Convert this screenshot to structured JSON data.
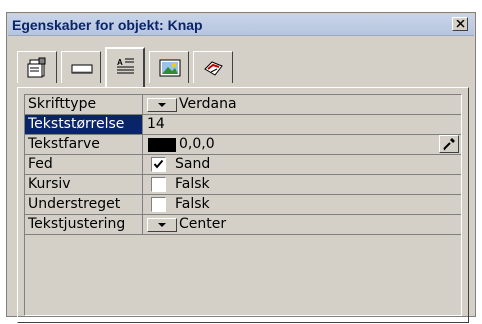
{
  "window": {
    "title": "Egenskaber for objekt: Knap"
  },
  "tabs": [
    {
      "name": "properties-icon",
      "active": false
    },
    {
      "name": "appearance-icon",
      "active": false
    },
    {
      "name": "text-icon",
      "active": true
    },
    {
      "name": "picture-icon",
      "active": false
    },
    {
      "name": "actions-icon",
      "active": false
    }
  ],
  "properties": [
    {
      "name": "Skrifttype",
      "value": "Verdana",
      "control": "dropdown",
      "selected": false
    },
    {
      "name": "Tekststørrelse",
      "value": "14",
      "control": "text",
      "selected": true
    },
    {
      "name": "Tekstfarve",
      "value": "0,0,0",
      "control": "color",
      "color": "#000000",
      "selected": false
    },
    {
      "name": "Fed",
      "value": "Sand",
      "control": "checkbox",
      "checked": true,
      "selected": false
    },
    {
      "name": "Kursiv",
      "value": "Falsk",
      "control": "checkbox",
      "checked": false,
      "selected": false
    },
    {
      "name": "Understreget",
      "value": "Falsk",
      "control": "checkbox",
      "checked": false,
      "selected": false
    },
    {
      "name": "Tekstjustering",
      "value": "Center",
      "control": "dropdown",
      "selected": false
    }
  ],
  "colors": {
    "selection": "#0a246a",
    "face": "#d4d0c8"
  }
}
